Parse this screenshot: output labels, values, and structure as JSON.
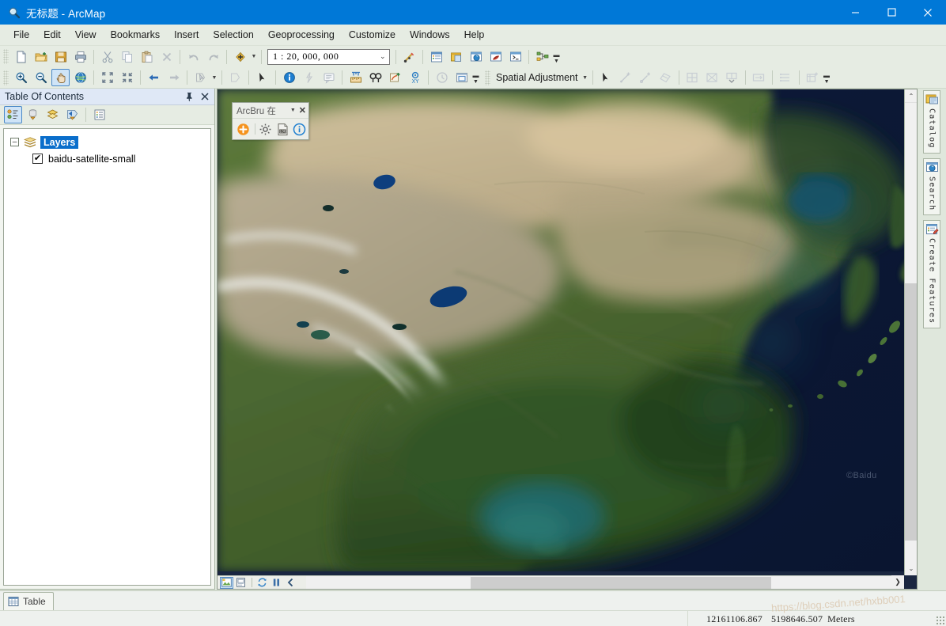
{
  "window": {
    "title": "无标题 - ArcMap",
    "icon": "arcmap-magnifier-icon",
    "minimize": "–",
    "maximize": "□",
    "close": "✕"
  },
  "menu": {
    "items": [
      {
        "label": "File"
      },
      {
        "label": "Edit"
      },
      {
        "label": "View"
      },
      {
        "label": "Bookmarks"
      },
      {
        "label": "Insert"
      },
      {
        "label": "Selection"
      },
      {
        "label": "Geoprocessing"
      },
      {
        "label": "Customize"
      },
      {
        "label": "Windows"
      },
      {
        "label": "Help"
      }
    ]
  },
  "standard_toolbar": {
    "scale_value": "1 : 20, 000, 000",
    "scale_placeholder": "1:20,000,000",
    "buttons": [
      {
        "name": "new-map-icon"
      },
      {
        "name": "open-icon"
      },
      {
        "name": "save-icon"
      },
      {
        "name": "print-icon"
      },
      {
        "name": "cut-icon"
      },
      {
        "name": "copy-icon"
      },
      {
        "name": "paste-icon"
      },
      {
        "name": "delete-icon"
      },
      {
        "name": "undo-icon"
      },
      {
        "name": "redo-icon"
      },
      {
        "name": "add-data-icon"
      },
      {
        "name": "editor-toolbar-icon"
      },
      {
        "name": "table-of-contents-icon"
      },
      {
        "name": "catalog-icon"
      },
      {
        "name": "search-icon"
      },
      {
        "name": "arctoolbox-icon"
      },
      {
        "name": "python-window-icon"
      },
      {
        "name": "model-builder-icon"
      }
    ]
  },
  "tools_toolbar": {
    "spatial_adjustment_label": "Spatial Adjustment",
    "buttons": [
      {
        "name": "zoom-in-icon"
      },
      {
        "name": "zoom-out-icon"
      },
      {
        "name": "pan-icon",
        "active": true
      },
      {
        "name": "full-extent-icon"
      },
      {
        "name": "fixed-zoom-in-icon"
      },
      {
        "name": "fixed-zoom-out-icon"
      },
      {
        "name": "go-back-extent-icon"
      },
      {
        "name": "go-forward-extent-icon"
      },
      {
        "name": "select-features-icon"
      },
      {
        "name": "clear-selection-icon"
      },
      {
        "name": "select-elements-icon"
      },
      {
        "name": "identify-icon"
      },
      {
        "name": "hyperlink-icon"
      },
      {
        "name": "html-popup-icon"
      },
      {
        "name": "measure-icon"
      },
      {
        "name": "find-icon"
      },
      {
        "name": "find-route-icon"
      },
      {
        "name": "go-to-xy-icon"
      },
      {
        "name": "time-slider-icon"
      },
      {
        "name": "create-viewer-window-icon"
      },
      {
        "name": "select-element-arrow-icon"
      },
      {
        "name": "new-displacement-link-icon"
      },
      {
        "name": "new-identity-link-icon"
      },
      {
        "name": "select-links-icon"
      },
      {
        "name": "new-multi-displacement-link-icon"
      },
      {
        "name": "edge-snap-icon"
      },
      {
        "name": "edge-match-icon"
      },
      {
        "name": "attribute-transfer-icon"
      },
      {
        "name": "link-table-icon"
      },
      {
        "name": "view-link-table-icon"
      }
    ]
  },
  "table_of_contents": {
    "title": "Table Of Contents",
    "pin_icon": "pin-icon",
    "close_icon": "close-icon",
    "toolbar_buttons": [
      {
        "name": "list-by-drawing-order-icon",
        "active": true
      },
      {
        "name": "list-by-source-icon"
      },
      {
        "name": "list-by-visibility-icon"
      },
      {
        "name": "list-by-selection-icon"
      },
      {
        "name": "options-icon"
      }
    ],
    "tree": {
      "root": {
        "label": "Layers",
        "expander": "–",
        "selected": true
      },
      "layers": [
        {
          "label": "baidu-satellite-small",
          "checked": true,
          "checkmark": "✔"
        }
      ]
    }
  },
  "arcbru_toolbar": {
    "title": "ArcBru 在",
    "dropdown_icon": "chevron-down-icon",
    "close_icon": "close-icon",
    "buttons": [
      {
        "name": "add-basemap-icon"
      },
      {
        "name": "settings-gear-icon"
      },
      {
        "name": "export-log-icon"
      },
      {
        "name": "about-info-icon"
      }
    ]
  },
  "map": {
    "basemap_attribution": "©Baidu",
    "bottom_buttons": [
      {
        "name": "data-view-icon",
        "active": true
      },
      {
        "name": "layout-view-icon"
      },
      {
        "name": "refresh-view-icon"
      },
      {
        "name": "pause-drawing-icon"
      },
      {
        "name": "previous-extent-icon"
      }
    ],
    "scrollbars": {
      "vertical_up": "⌃",
      "vertical_down": "⌄",
      "horizontal_right": "❯"
    }
  },
  "right_dock": {
    "tabs": [
      {
        "label": "Catalog",
        "icon": "catalog-icon"
      },
      {
        "label": "Search",
        "icon": "search-icon"
      },
      {
        "label": "Create Features",
        "icon": "create-features-icon"
      }
    ]
  },
  "bottom": {
    "table_tab": {
      "label": "Table",
      "icon": "table-icon"
    }
  },
  "status_bar": {
    "coordinates_x": "12161106.867",
    "coordinates_y": "5198646.507",
    "units": "Meters",
    "watermark": "https://blog.csdn.net/hxbb001"
  }
}
